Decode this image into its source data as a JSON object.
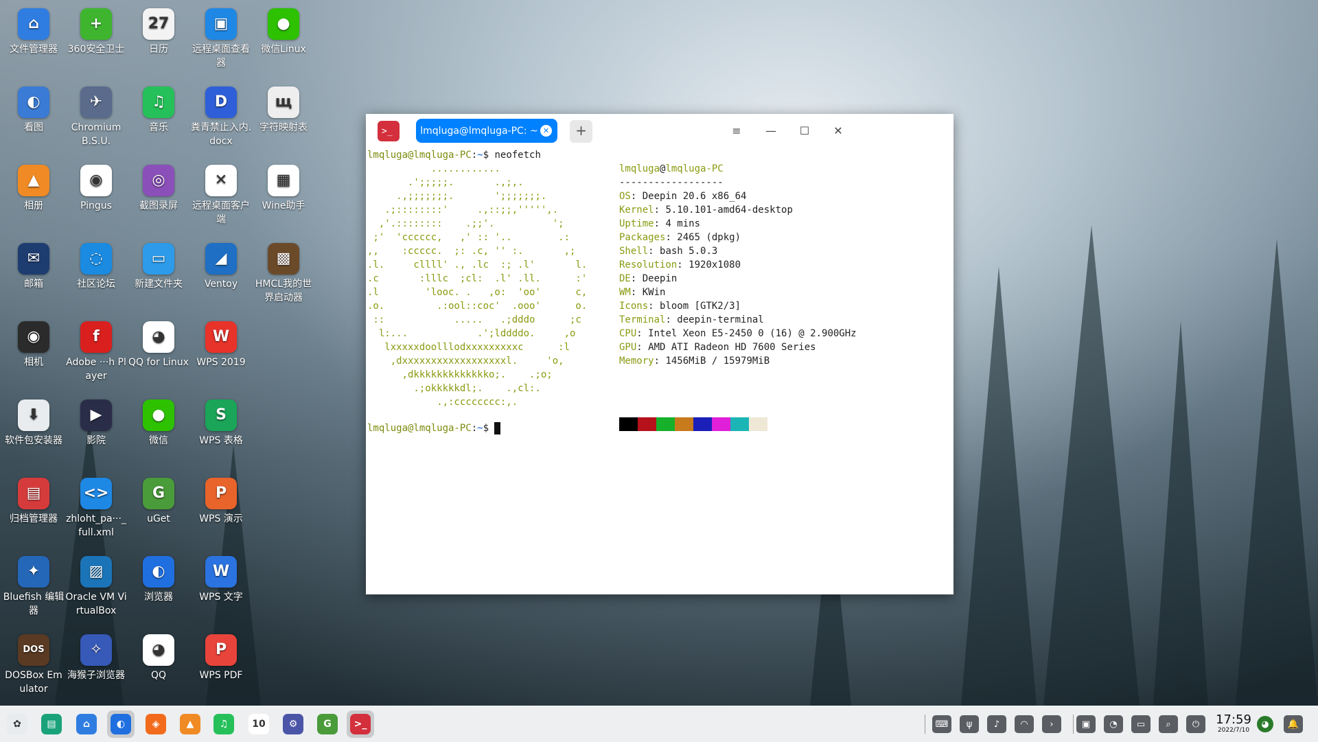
{
  "desktop": {
    "icons": [
      {
        "label": "文件管理器",
        "icon": "file-manager-icon",
        "color": "#2f7de1",
        "glyph": "⌂",
        "col": 0,
        "row": 0
      },
      {
        "label": "360安全卫士",
        "icon": "shield-360-icon",
        "color": "#3fb52f",
        "glyph": "+",
        "col": 1,
        "row": 0
      },
      {
        "label": "日历",
        "icon": "calendar-icon",
        "color": "#f3f3f3",
        "glyph": "27",
        "col": 2,
        "row": 0
      },
      {
        "label": "远程桌面查看器",
        "icon": "remote-viewer-icon",
        "color": "#1f88e5",
        "glyph": "▣",
        "col": 3,
        "row": 0
      },
      {
        "label": "微信Linux",
        "icon": "wechat-icon",
        "color": "#2dc100",
        "glyph": "●",
        "col": 4,
        "row": 0
      },
      {
        "label": "看图",
        "icon": "image-viewer-icon",
        "color": "#3a7bd5",
        "glyph": "◐",
        "col": 0,
        "row": 1
      },
      {
        "label": "Chromium B.S.U.",
        "icon": "chromium-bsu-icon",
        "color": "#5a6b8c",
        "glyph": "✈",
        "col": 1,
        "row": 1
      },
      {
        "label": "音乐",
        "icon": "music-icon",
        "color": "#26c05a",
        "glyph": "♫",
        "col": 2,
        "row": 1
      },
      {
        "label": "粪青禁止入内.docx",
        "icon": "docx-icon",
        "color": "#2f5fd8",
        "glyph": "D",
        "col": 3,
        "row": 1
      },
      {
        "label": "字符映射表",
        "icon": "charmap-icon",
        "color": "#eeeeee",
        "glyph": "щ",
        "col": 4,
        "row": 1
      },
      {
        "label": "相册",
        "icon": "album-icon",
        "color": "#f08a24",
        "glyph": "▲",
        "col": 0,
        "row": 2
      },
      {
        "label": "Pingus",
        "icon": "pingus-icon",
        "color": "#ffffff",
        "glyph": "◉",
        "col": 1,
        "row": 2
      },
      {
        "label": "截图录屏",
        "icon": "screenshot-icon",
        "color": "#8a4fb8",
        "glyph": "◎",
        "col": 2,
        "row": 2
      },
      {
        "label": "远程桌面客户端",
        "icon": "remote-client-icon",
        "color": "#ffffff",
        "glyph": "✕",
        "col": 3,
        "row": 2
      },
      {
        "label": "Wine助手",
        "icon": "wine-icon",
        "color": "#ffffff",
        "glyph": "▦",
        "col": 4,
        "row": 2
      },
      {
        "label": "邮箱",
        "icon": "mail-icon",
        "color": "#1d3c70",
        "glyph": "✉",
        "col": 0,
        "row": 3
      },
      {
        "label": "社区论坛",
        "icon": "deepin-forum-icon",
        "color": "#1a8be0",
        "glyph": "◌",
        "col": 1,
        "row": 3
      },
      {
        "label": "新建文件夹",
        "icon": "folder-icon",
        "color": "#2d9bea",
        "glyph": "▭",
        "col": 2,
        "row": 3
      },
      {
        "label": "Ventoy",
        "icon": "ventoy-icon",
        "color": "#1f6fc4",
        "glyph": "◢",
        "col": 3,
        "row": 3
      },
      {
        "label": "HMCL我的世界启动器",
        "icon": "hmcl-icon",
        "color": "#6b4a2a",
        "glyph": "▩",
        "col": 4,
        "row": 3
      },
      {
        "label": "相机",
        "icon": "camera-icon",
        "color": "#2b2b2b",
        "glyph": "◉",
        "col": 0,
        "row": 4
      },
      {
        "label": "Adobe ···h Player",
        "icon": "flash-player-icon",
        "color": "#d9201e",
        "glyph": "f",
        "col": 1,
        "row": 4
      },
      {
        "label": "QQ for Linux",
        "icon": "qq-linux-icon",
        "color": "#ffffff",
        "glyph": "◕",
        "col": 2,
        "row": 4
      },
      {
        "label": "WPS 2019",
        "icon": "wps-2019-icon",
        "color": "#e8332b",
        "glyph": "W",
        "col": 3,
        "row": 4
      },
      {
        "label": "软件包安装器",
        "icon": "package-installer-icon",
        "color": "#e9ecef",
        "glyph": "⬇",
        "col": 0,
        "row": 5
      },
      {
        "label": "影院",
        "icon": "movie-icon",
        "color": "#2a2d48",
        "glyph": "▶",
        "col": 1,
        "row": 5
      },
      {
        "label": "微信",
        "icon": "wechat-icon",
        "color": "#2dc100",
        "glyph": "●",
        "col": 2,
        "row": 5
      },
      {
        "label": "WPS 表格",
        "icon": "wps-spreadsheet-icon",
        "color": "#1aa558",
        "glyph": "S",
        "col": 3,
        "row": 5
      },
      {
        "label": "归档管理器",
        "icon": "archive-icon",
        "color": "#d63b3b",
        "glyph": "▤",
        "col": 0,
        "row": 6
      },
      {
        "label": "zhloht_pa···_full.xml",
        "icon": "xml-file-icon",
        "color": "#1e88e5",
        "glyph": "<>",
        "col": 1,
        "row": 6
      },
      {
        "label": "uGet",
        "icon": "uget-icon",
        "color": "#4a9b3a",
        "glyph": "G",
        "col": 2,
        "row": 6
      },
      {
        "label": "WPS 演示",
        "icon": "wps-presentation-icon",
        "color": "#e8642b",
        "glyph": "P",
        "col": 3,
        "row": 6
      },
      {
        "label": "Bluefish 编辑器",
        "icon": "bluefish-icon",
        "color": "#2466b8",
        "glyph": "✦",
        "col": 0,
        "row": 7
      },
      {
        "label": "Oracle VM VirtualBox",
        "icon": "virtualbox-icon",
        "color": "#1b74b8",
        "glyph": "▨",
        "col": 1,
        "row": 7
      },
      {
        "label": "浏览器",
        "icon": "browser-icon",
        "color": "#1f6fe0",
        "glyph": "◐",
        "col": 2,
        "row": 7
      },
      {
        "label": "WPS 文字",
        "icon": "wps-writer-icon",
        "color": "#2a73e0",
        "glyph": "W",
        "col": 3,
        "row": 7
      },
      {
        "label": "DOSBox Emulator",
        "icon": "dosbox-icon",
        "color": "#5a3a22",
        "glyph": "DOS",
        "col": 0,
        "row": 8
      },
      {
        "label": "海猴子浏览器",
        "icon": "seamonkey-icon",
        "color": "#3759b8",
        "glyph": "✧",
        "col": 1,
        "row": 8
      },
      {
        "label": "QQ",
        "icon": "qq-icon",
        "color": "#ffffff",
        "glyph": "◕",
        "col": 2,
        "row": 8
      },
      {
        "label": "WPS PDF",
        "icon": "wps-pdf-icon",
        "color": "#e8443b",
        "glyph": "P",
        "col": 3,
        "row": 8
      }
    ]
  },
  "terminal": {
    "tab_title": "lmqluga@lmqluga-PC: ~",
    "new_tab": "+",
    "menu": "≡",
    "minimize": "—",
    "maximize": "☐",
    "close": "✕",
    "app_glyph": ">_",
    "prompt_user": "lmqluga@lmqluga-PC",
    "prompt_sep": ":",
    "prompt_path": "~",
    "prompt_dollar": "$",
    "command": "neofetch",
    "ascii_art": "           ............\n       .';;;;;.       .,;,.\n     .,;;;;;;;.       ';;;;;;;.\n   .;::::::::'     .,::;;,''''',.\n  ,'.::::::::    .;;'.          ';\n ;'  'cccccc,   ,' :: '..        .:\n,,    :ccccc.  ;: .c, '' :.       ,;\n.l.     cllll' ., .lc  :; .l'       l.\n.c       :lllc  ;cl:  .l' .ll.      :'\n.l        'looc. .   ,o:  'oo'      c,\n.o.         .:ool::coc'  .ooo'      o.\n ::            .....   .;dddo      ;c\n  l:...            .';lddddo.     ,o\n   lxxxxxdoolllodxxxxxxxxxc      :l\n    ,dxxxxxxxxxxxxxxxxxxl.     'o,\n      ,dkkkkkkkkkkkkko;.    .;o;\n        .;okkkkkdl;.    .,cl:.\n            .,:cccccccc:,.",
    "header_user": "lmqluga",
    "header_at": "@",
    "header_host": "lmqluga-PC",
    "separator": "------------------",
    "info": [
      {
        "key": "OS",
        "value": "Deepin 20.6 x86_64"
      },
      {
        "key": "Kernel",
        "value": "5.10.101-amd64-desktop"
      },
      {
        "key": "Uptime",
        "value": "4 mins"
      },
      {
        "key": "Packages",
        "value": "2465 (dpkg)"
      },
      {
        "key": "Shell",
        "value": "bash 5.0.3"
      },
      {
        "key": "Resolution",
        "value": "1920x1080"
      },
      {
        "key": "DE",
        "value": "Deepin"
      },
      {
        "key": "WM",
        "value": "KWin"
      },
      {
        "key": "Icons",
        "value": "bloom [GTK2/3]"
      },
      {
        "key": "Terminal",
        "value": "deepin-terminal"
      },
      {
        "key": "CPU",
        "value": "Intel Xeon E5-2450 0 (16) @ 2.900GHz"
      },
      {
        "key": "GPU",
        "value": "AMD ATI Radeon HD 7600 Series"
      },
      {
        "key": "Memory",
        "value": "1456MiB / 15979MiB"
      }
    ],
    "palette": [
      "#000000",
      "#b5121b",
      "#16b02a",
      "#c77b1c",
      "#1a1fb8",
      "#e01fd9",
      "#1cb5b5",
      "#efe8d6"
    ]
  },
  "taskbar": {
    "apps": [
      {
        "icon": "launcher-icon",
        "color": "#e9ecef",
        "glyph": "✿",
        "active": false
      },
      {
        "icon": "multitask-view-icon",
        "color": "#1aa37a",
        "glyph": "▤",
        "active": false
      },
      {
        "icon": "file-manager-icon",
        "color": "#2f7de1",
        "glyph": "⌂",
        "active": false
      },
      {
        "icon": "browser-icon",
        "color": "#1f6fe0",
        "glyph": "◐",
        "active": true
      },
      {
        "icon": "app-store-icon",
        "color": "#f26b1d",
        "glyph": "◈",
        "active": false
      },
      {
        "icon": "album-icon",
        "color": "#f08a24",
        "glyph": "▲",
        "active": false
      },
      {
        "icon": "music-icon",
        "color": "#26c05a",
        "glyph": "♫",
        "active": false
      },
      {
        "icon": "calendar-icon",
        "color": "#ffffff",
        "glyph": "10",
        "active": false
      },
      {
        "icon": "control-center-icon",
        "color": "#4b55a8",
        "glyph": "⚙",
        "active": false
      },
      {
        "icon": "uget-icon",
        "color": "#4a9b3a",
        "glyph": "G",
        "active": false
      },
      {
        "icon": "terminal-icon",
        "color": "#d32f3c",
        "glyph": ">_",
        "active": true
      }
    ],
    "tray": [
      {
        "icon": "keyboard-icon",
        "glyph": "⌨"
      },
      {
        "icon": "usb-icon",
        "glyph": "ψ"
      },
      {
        "icon": "volume-icon",
        "glyph": "♪"
      },
      {
        "icon": "network-icon",
        "glyph": "◠"
      },
      {
        "icon": "expand-tray-icon",
        "glyph": "›"
      },
      {
        "icon": "multitask-icon",
        "glyph": "▣"
      },
      {
        "icon": "system-monitor-icon",
        "glyph": "◔"
      },
      {
        "icon": "screen-icon",
        "glyph": "▭"
      },
      {
        "icon": "search-icon",
        "glyph": "⌕"
      },
      {
        "icon": "power-icon",
        "glyph": "⏻"
      }
    ],
    "time": "17:59",
    "date": "2022/7/10",
    "notification_glyph": "🔔",
    "user_glyph": "◕"
  }
}
